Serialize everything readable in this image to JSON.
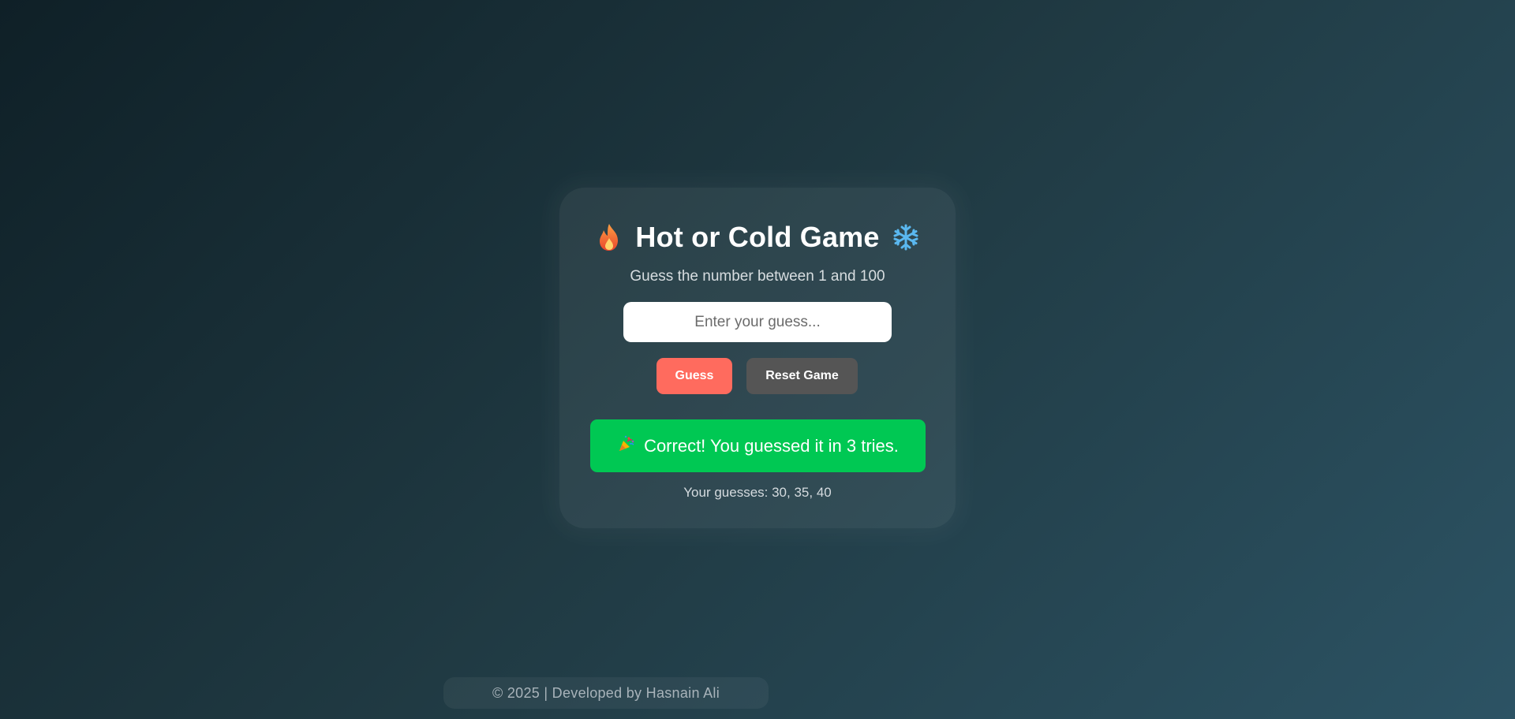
{
  "game": {
    "title": "Hot or Cold Game",
    "title_left_icon": "fire-icon",
    "title_right_icon": "snowflake-icon",
    "subtitle": "Guess the number between 1 and 100",
    "input": {
      "value": "",
      "placeholder": "Enter your guess..."
    },
    "buttons": {
      "guess_label": "Guess",
      "reset_label": "Reset Game"
    },
    "result": {
      "icon": "party-popper-icon",
      "message": "Correct! You guessed it in 3 tries."
    },
    "history": "Your guesses: 30, 35, 40"
  },
  "footer": {
    "text": "© 2025 | Developed by Hasnain Ali"
  },
  "colors": {
    "guess_button": "#ff6b5e",
    "reset_button": "#555555",
    "success": "#00c853"
  }
}
